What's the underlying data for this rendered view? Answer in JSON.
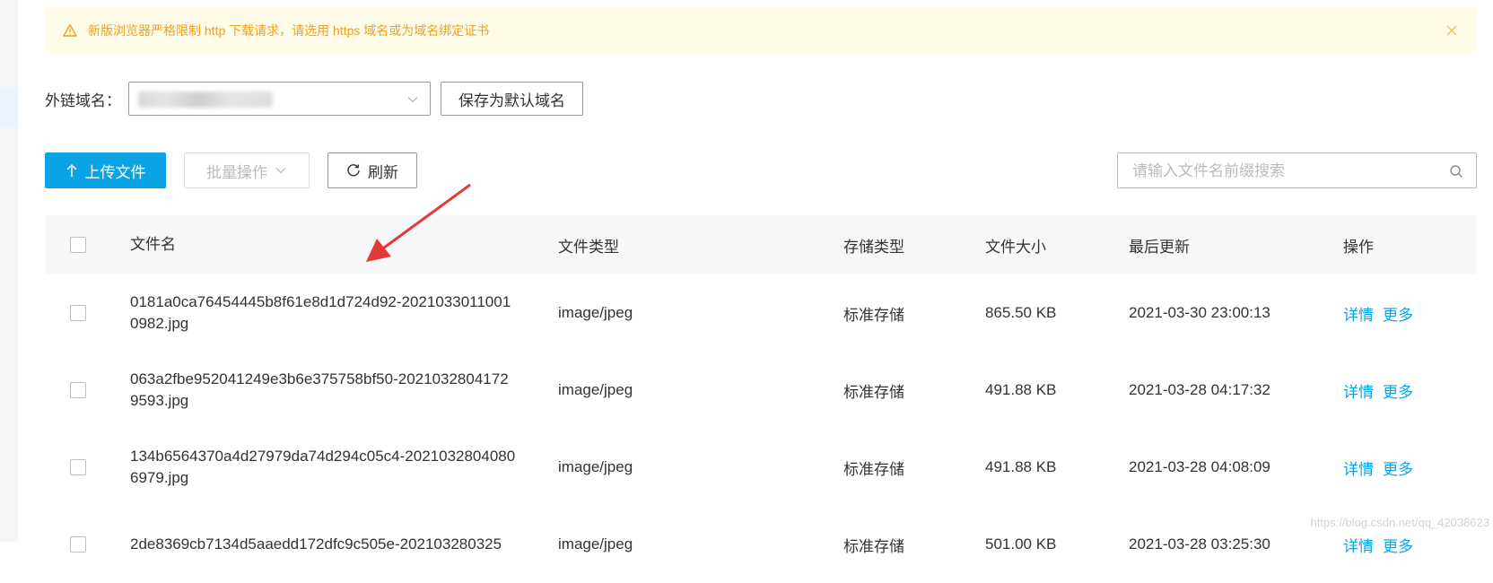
{
  "alert": {
    "message": "新版浏览器严格限制 http 下载请求，请选用 https 域名或为域名绑定证书",
    "icon": "warning-icon",
    "color": "#f0a020",
    "background": "#fefbe8"
  },
  "domain": {
    "label": "外链域名：",
    "selected_value": "",
    "save_default_label": "保存为默认域名"
  },
  "toolbar": {
    "upload_label": "上传文件",
    "batch_label": "批量操作",
    "refresh_label": "刷新",
    "search_placeholder": "请输入文件名前缀搜索"
  },
  "table": {
    "headers": {
      "name": "文件名",
      "type": "文件类型",
      "storage": "存储类型",
      "size": "文件大小",
      "updated": "最后更新",
      "ops": "操作"
    },
    "rows": [
      {
        "name": "0181a0ca76454445b8f61e8d1d724d92-20210330110010982.jpg",
        "type": "image/jpeg",
        "storage": "标准存储",
        "size": "865.50 KB",
        "updated": "2021-03-30 23:00:13",
        "detail": "详情",
        "more": "更多"
      },
      {
        "name": "063a2fbe952041249e3b6e375758bf50-20210328041729593.jpg",
        "type": "image/jpeg",
        "storage": "标准存储",
        "size": "491.88 KB",
        "updated": "2021-03-28 04:17:32",
        "detail": "详情",
        "more": "更多"
      },
      {
        "name": "134b6564370a4d27979da74d294c05c4-20210328040806979.jpg",
        "type": "image/jpeg",
        "storage": "标准存储",
        "size": "491.88 KB",
        "updated": "2021-03-28 04:08:09",
        "detail": "详情",
        "more": "更多"
      },
      {
        "name": "2de8369cb7134d5aaedd172dfc9c505e-202103280325",
        "type": "image/jpeg",
        "storage": "标准存储",
        "size": "501.00 KB",
        "updated": "2021-03-28 03:25:30",
        "detail": "详情",
        "more": "更多"
      }
    ]
  },
  "watermark": "https://blog.csdn.net/qq_42038623",
  "colors": {
    "accent": "#0aa4e6",
    "annotation_arrow": "#e53935"
  }
}
